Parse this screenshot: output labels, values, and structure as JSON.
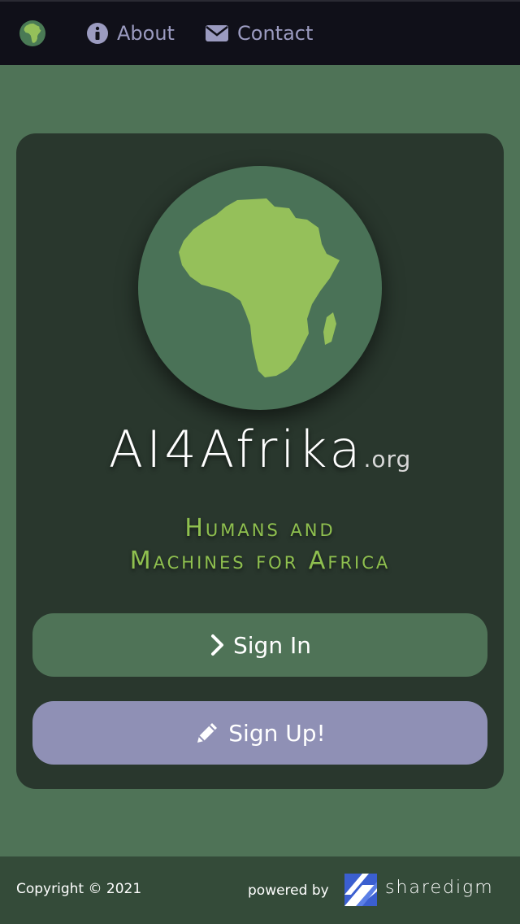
{
  "nav": {
    "logo": "africa-globe-icon",
    "about_label": "About",
    "about_icon": "info-circle-icon",
    "contact_label": "Contact",
    "contact_icon": "envelope-icon"
  },
  "hero": {
    "logo": "africa-globe-icon",
    "brand_name": "AI4Afrika",
    "brand_tld": ".org",
    "tagline_line1": "Humans and",
    "tagline_line2": "Machines for Africa"
  },
  "actions": {
    "signin_label": "Sign In",
    "signin_icon": "chevron-right-icon",
    "signup_label": "Sign Up!",
    "signup_icon": "pencil-icon"
  },
  "footer": {
    "copyright": "Copyright © 2021",
    "powered_by": "powered by",
    "partner_name": "sharedigm",
    "partner_logo": "sharedigm-logo"
  },
  "colors": {
    "page_bg": "#4f7357",
    "navbar_bg": "#101019",
    "card_bg": "#29372d",
    "accent_green": "#8fc04f",
    "signin_bg": "#4f7357",
    "signup_bg": "#8f90b5",
    "nav_link": "#9b9bc0",
    "footer_bg": "#344b39"
  }
}
